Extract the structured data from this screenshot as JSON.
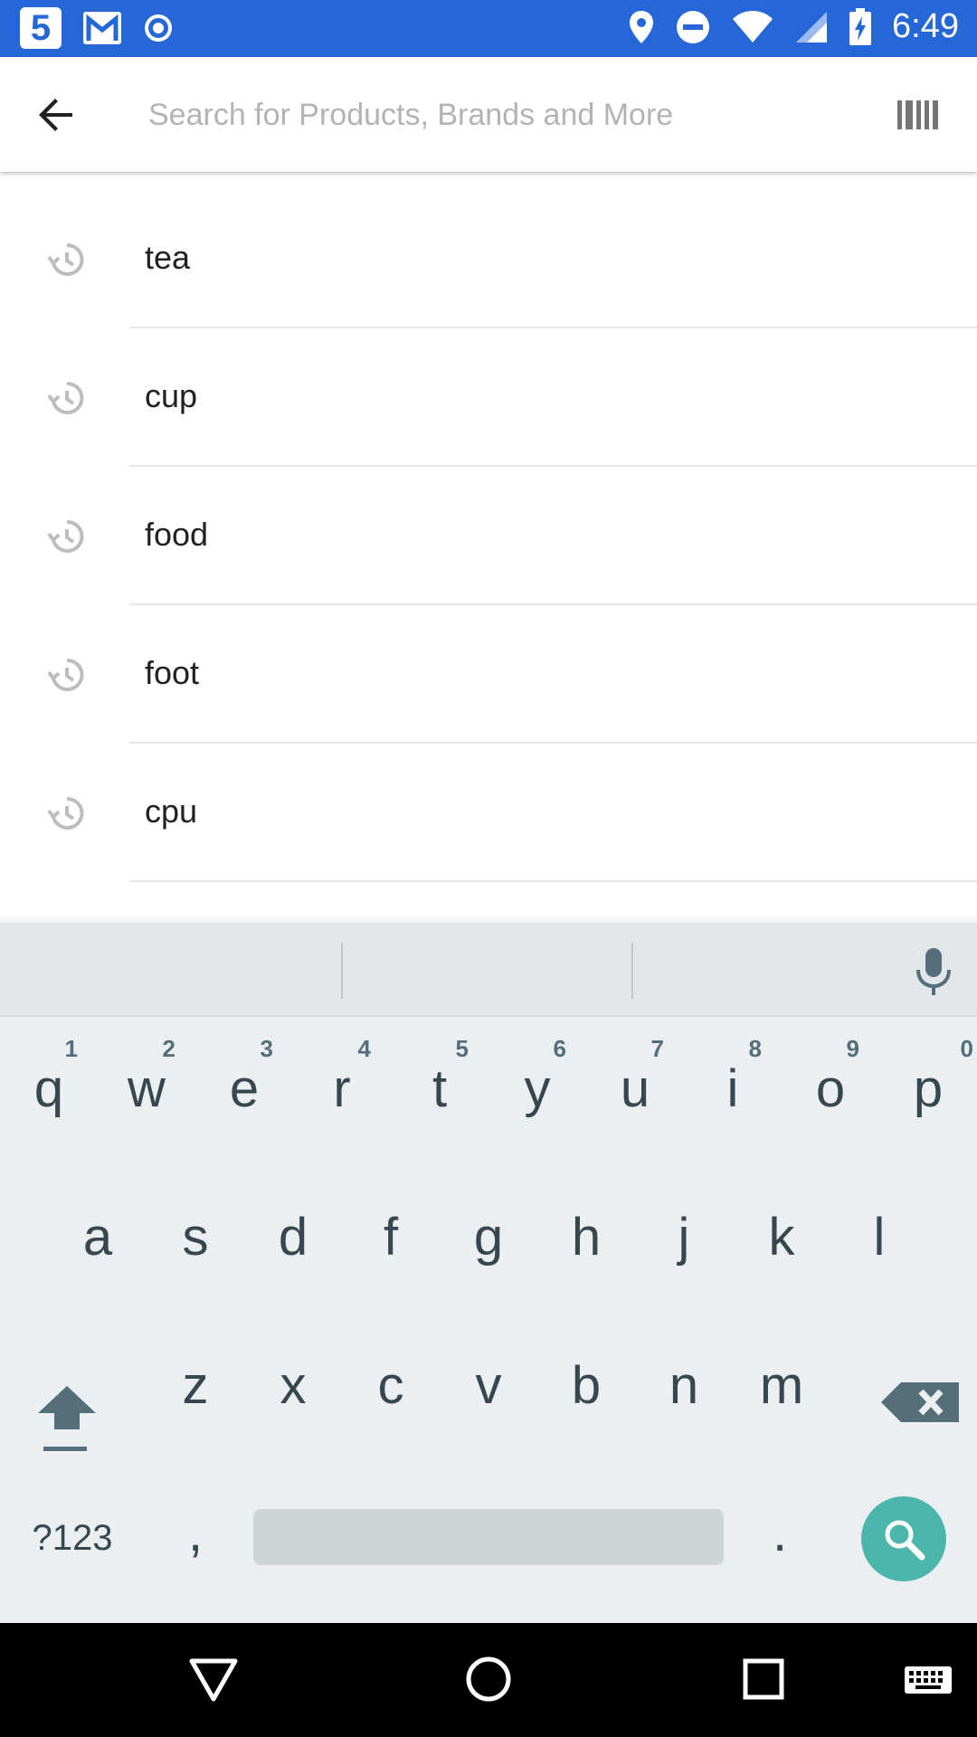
{
  "status_bar": {
    "time": "6:49",
    "app_badge": "5",
    "left_icons": [
      "app5-icon",
      "gmail-icon",
      "record-icon"
    ],
    "right_icons": [
      "location-icon",
      "dnd-icon",
      "wifi-icon",
      "signal-icon",
      "battery-charging-icon"
    ]
  },
  "search": {
    "placeholder": "Search for Products, Brands and More",
    "value": ""
  },
  "history": [
    {
      "label": "tea"
    },
    {
      "label": "cup"
    },
    {
      "label": "food"
    },
    {
      "label": "foot"
    },
    {
      "label": "cpu"
    }
  ],
  "keyboard": {
    "row1": [
      {
        "ch": "q",
        "num": "1"
      },
      {
        "ch": "w",
        "num": "2"
      },
      {
        "ch": "e",
        "num": "3"
      },
      {
        "ch": "r",
        "num": "4"
      },
      {
        "ch": "t",
        "num": "5"
      },
      {
        "ch": "y",
        "num": "6"
      },
      {
        "ch": "u",
        "num": "7"
      },
      {
        "ch": "i",
        "num": "8"
      },
      {
        "ch": "o",
        "num": "9"
      },
      {
        "ch": "p",
        "num": "0"
      }
    ],
    "row2": [
      "a",
      "s",
      "d",
      "f",
      "g",
      "h",
      "j",
      "k",
      "l"
    ],
    "row3": [
      "z",
      "x",
      "c",
      "v",
      "b",
      "n",
      "m"
    ],
    "symbols_label": "?123",
    "comma": ",",
    "period": "."
  },
  "colors": {
    "status_bar": "#2567d6",
    "search_key": "#4db6ac",
    "keyboard_bg": "#eceff1"
  }
}
